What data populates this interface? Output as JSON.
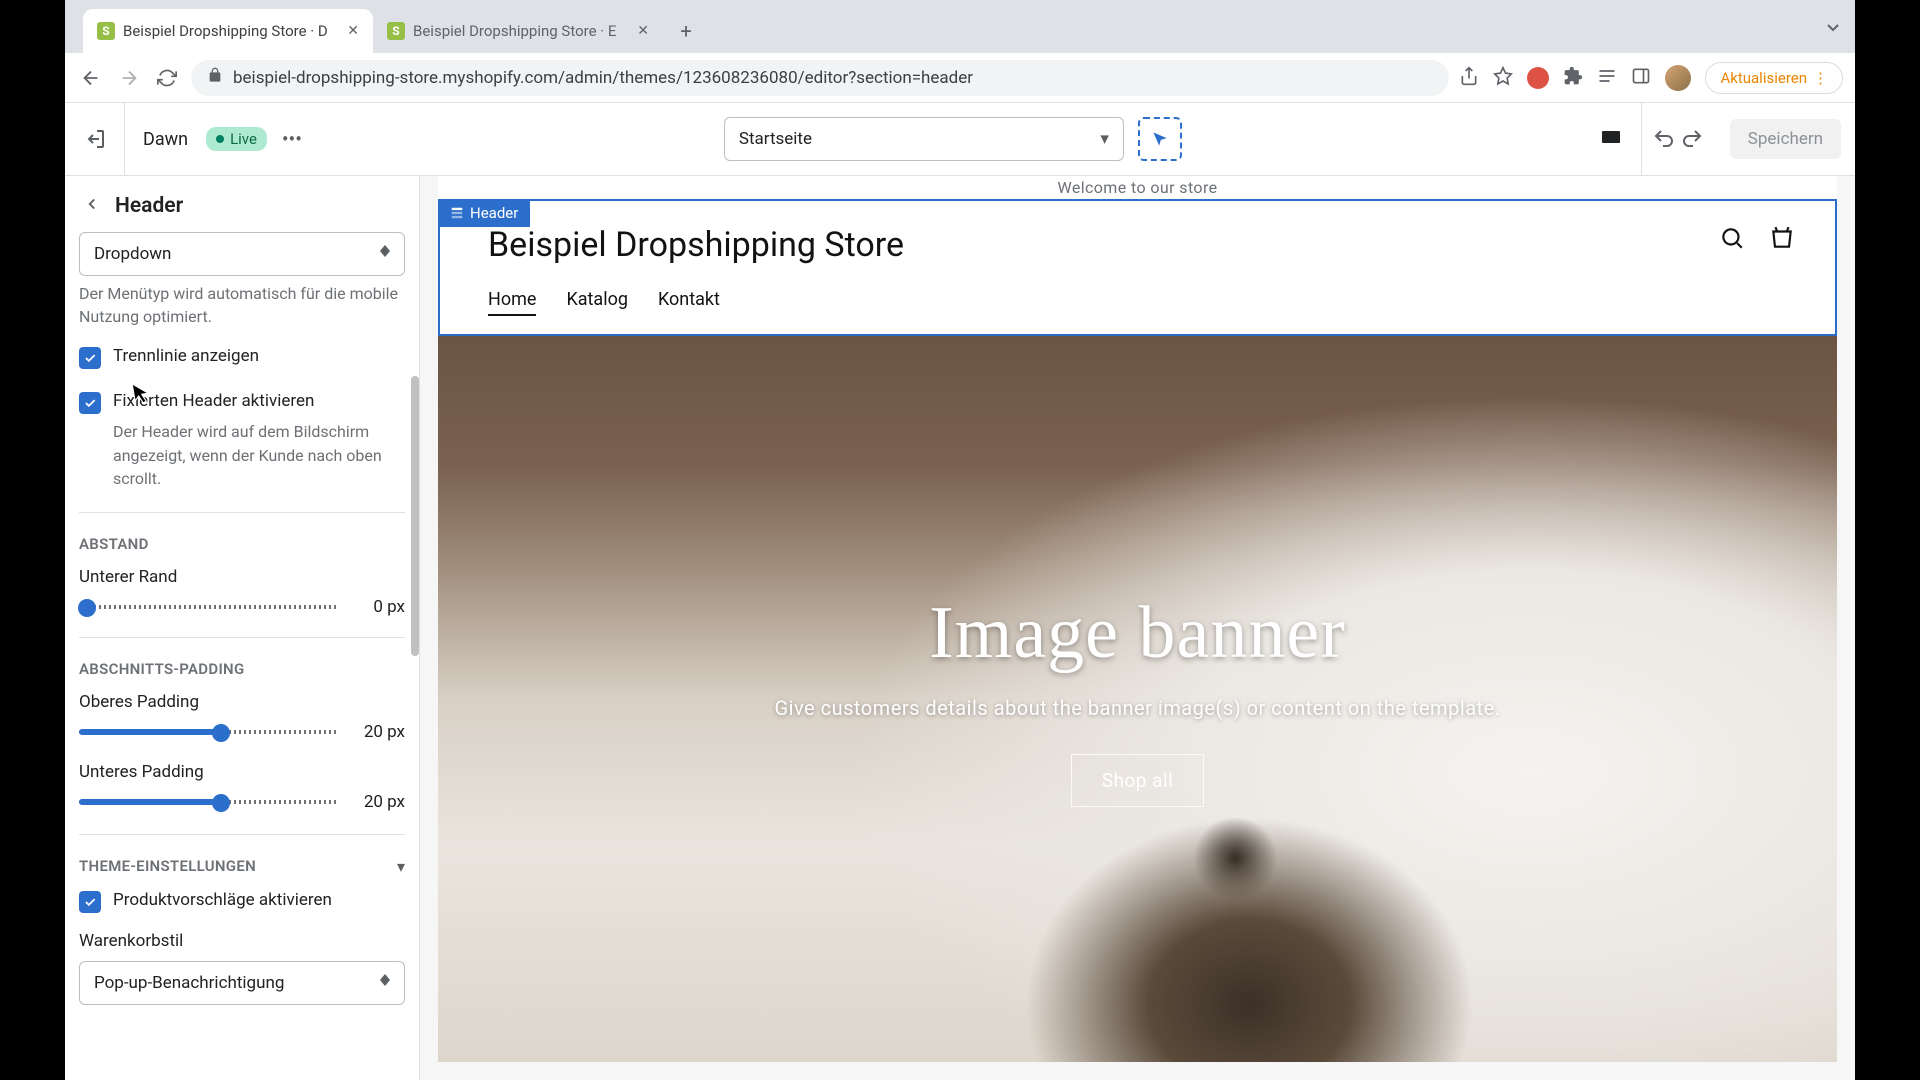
{
  "browser": {
    "tab1": "Beispiel Dropshipping Store · D",
    "tab2": "Beispiel Dropshipping Store · E",
    "url": "beispiel-dropshipping-store.myshopify.com/admin/themes/123608236080/editor?section=header",
    "update": "Aktualisieren"
  },
  "appbar": {
    "theme": "Dawn",
    "live": "Live",
    "page": "Startseite",
    "save": "Speichern"
  },
  "sidebar": {
    "title": "Header",
    "menu_type_value": "Dropdown",
    "menu_type_help": "Der Menütyp wird automatisch für die mobile Nutzung optimiert.",
    "show_line": "Trennlinie anzeigen",
    "sticky": "Fixierten Header aktivieren",
    "sticky_help": "Der Header wird auf dem Bildschirm angezeigt, wenn der Kunde nach oben scrollt.",
    "abstand_title": "ABSTAND",
    "bottom_margin_label": "Unterer Rand",
    "bottom_margin_val": "0 px",
    "padding_title": "ABSCHNITTS-PADDING",
    "top_pad_label": "Oberes Padding",
    "top_pad_val": "20 px",
    "bottom_pad_label": "Unteres Padding",
    "bottom_pad_val": "20 px",
    "theme_title": "THEME-EINSTELLUNGEN",
    "predictive": "Produktvorschläge aktivieren",
    "cart_label": "Warenkorbstil",
    "cart_value": "Pop-up-Benachrichtigung"
  },
  "preview": {
    "welcome": "Welcome to our store",
    "header_tag": "Header",
    "store": "Beispiel Dropshipping Store",
    "nav_home": "Home",
    "nav_katalog": "Katalog",
    "nav_kontakt": "Kontakt",
    "banner_title": "Image banner",
    "banner_sub": "Give customers details about the banner image(s) or content on the template.",
    "banner_cta": "Shop all"
  }
}
